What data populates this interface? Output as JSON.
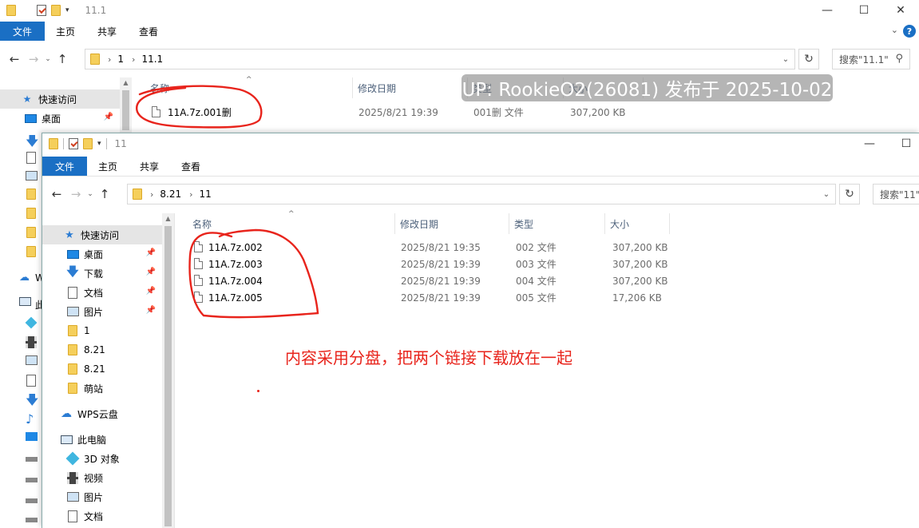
{
  "back_window": {
    "title": "11.1",
    "ribbon_tabs": [
      "文件",
      "主页",
      "共享",
      "查看"
    ],
    "breadcrumb": [
      "1",
      "11.1"
    ],
    "search_placeholder": "搜索\"11.1\"",
    "columns": {
      "name": "名称",
      "date": "修改日期",
      "type": "类型",
      "size": "大小"
    },
    "files": [
      {
        "name": "11A.7z.001删",
        "date": "2025/8/21 19:39",
        "type": "001删 文件",
        "size": "307,200 KB"
      }
    ],
    "sidebar": {
      "quick_access": "快速访问",
      "desktop": "桌面"
    }
  },
  "front_window": {
    "title": "11",
    "ribbon_tabs": [
      "文件",
      "主页",
      "共享",
      "查看"
    ],
    "breadcrumb": [
      "8.21",
      "11"
    ],
    "search_placeholder": "搜索\"11\"",
    "columns": {
      "name": "名称",
      "date": "修改日期",
      "type": "类型",
      "size": "大小"
    },
    "files": [
      {
        "name": "11A.7z.002",
        "date": "2025/8/21 19:35",
        "type": "002 文件",
        "size": "307,200 KB"
      },
      {
        "name": "11A.7z.003",
        "date": "2025/8/21 19:39",
        "type": "003 文件",
        "size": "307,200 KB"
      },
      {
        "name": "11A.7z.004",
        "date": "2025/8/21 19:39",
        "type": "004 文件",
        "size": "307,200 KB"
      },
      {
        "name": "11A.7z.005",
        "date": "2025/8/21 19:39",
        "type": "005 文件",
        "size": "17,206 KB"
      }
    ],
    "sidebar": [
      {
        "label": "快速访问",
        "icon": "star-icon",
        "pinned": false,
        "selected": true
      },
      {
        "label": "桌面",
        "icon": "desktop-icon",
        "pinned": true
      },
      {
        "label": "下载",
        "icon": "download-icon",
        "pinned": true
      },
      {
        "label": "文档",
        "icon": "document-icon",
        "pinned": true
      },
      {
        "label": "图片",
        "icon": "picture-icon",
        "pinned": true
      },
      {
        "label": "1",
        "icon": "folder-icon",
        "pinned": false
      },
      {
        "label": "8.21",
        "icon": "folder-icon",
        "pinned": false
      },
      {
        "label": "8.21",
        "icon": "folder-icon",
        "pinned": false
      },
      {
        "label": "萌站",
        "icon": "folder-icon",
        "pinned": false
      },
      {
        "label": "WPS云盘",
        "icon": "cloud-icon",
        "pinned": false
      },
      {
        "label": "此电脑",
        "icon": "computer-icon",
        "pinned": false
      },
      {
        "label": "3D 对象",
        "icon": "3d-objects-icon",
        "pinned": false
      },
      {
        "label": "视频",
        "icon": "video-icon",
        "pinned": false
      },
      {
        "label": "图片",
        "icon": "picture-icon",
        "pinned": false
      },
      {
        "label": "文档",
        "icon": "document-icon",
        "pinned": false
      }
    ]
  },
  "watermark": "UP: RookieO2(26081) 发布于 2025-10-02",
  "annotation": "内容采用分盘，把两个链接下载放在一起",
  "colors": {
    "file_tab": "#1a6fc4",
    "annotation_red": "#e8241c",
    "folder": "#f5cf5b"
  }
}
